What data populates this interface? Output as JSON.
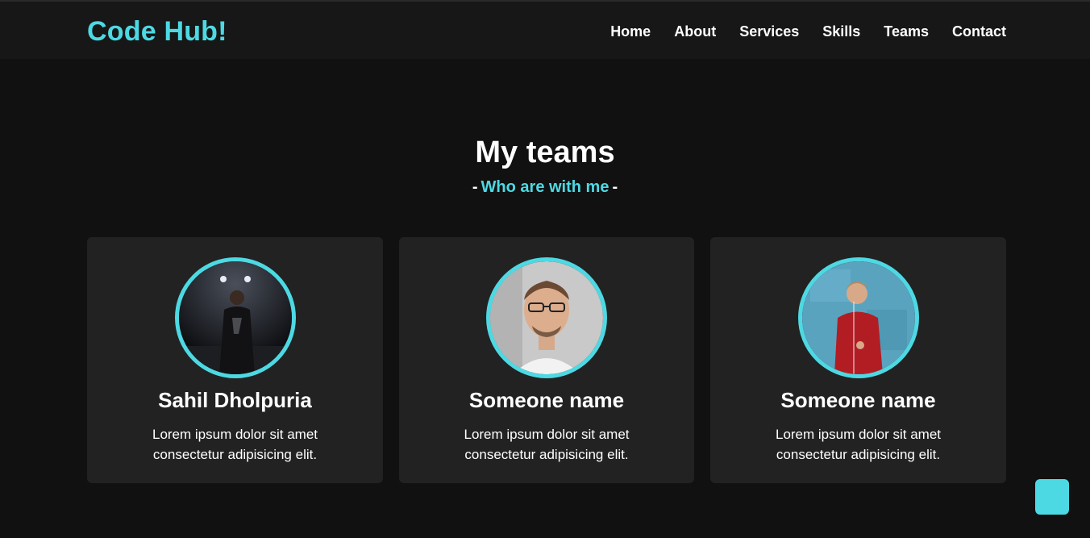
{
  "brand": {
    "logo": "Code Hub!",
    "accent_color": "#4dd9e3"
  },
  "nav": {
    "items": [
      {
        "label": "Home"
      },
      {
        "label": "About"
      },
      {
        "label": "Services"
      },
      {
        "label": "Skills"
      },
      {
        "label": "Teams"
      },
      {
        "label": "Contact"
      }
    ]
  },
  "teams": {
    "title": "My teams",
    "subtitle_prefix": "-",
    "subtitle": "Who are with me",
    "subtitle_suffix": "-",
    "members": [
      {
        "name": "Sahil Dholpuria",
        "desc_line1": "Lorem ipsum dolor sit amet",
        "desc_line2": "consectetur adipisicing elit.",
        "photo": "man-night-photo"
      },
      {
        "name": "Someone name",
        "desc_line1": "Lorem ipsum dolor sit amet",
        "desc_line2": "consectetur adipisicing elit.",
        "photo": "man-glasses-photo"
      },
      {
        "name": "Someone name",
        "desc_line1": "Lorem ipsum dolor sit amet",
        "desc_line2": "consectetur adipisicing elit.",
        "photo": "man-red-sweater-photo"
      }
    ]
  },
  "scroll_top": {
    "icon": "scroll-up-icon"
  }
}
